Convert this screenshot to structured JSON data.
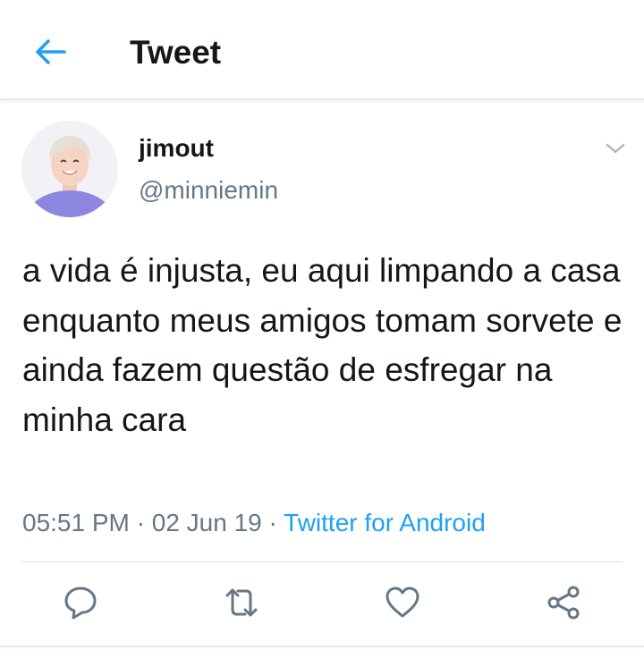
{
  "header": {
    "title": "Tweet",
    "back_icon": "back-arrow-icon",
    "accent_color": "#1da1f2"
  },
  "tweet": {
    "display_name": "jimout",
    "handle": "@minniemin",
    "text": "a vida é injusta, eu aqui limpando a casa enquanto meus amigos tomam sorvete e ainda fazem questão de esfregar na minha cara",
    "time": "05:51 PM",
    "date": "02 Jun 19",
    "separator": "·",
    "source": "Twitter for Android",
    "caret_icon": "chevron-down-icon"
  },
  "actions": [
    {
      "name": "reply",
      "icon": "reply-icon"
    },
    {
      "name": "retweet",
      "icon": "retweet-icon"
    },
    {
      "name": "like",
      "icon": "heart-icon"
    },
    {
      "name": "share",
      "icon": "share-icon"
    }
  ],
  "colors": {
    "text": "#14171a",
    "secondary_text": "#657786",
    "link": "#1da1f2",
    "divider": "#e1e8ed"
  }
}
